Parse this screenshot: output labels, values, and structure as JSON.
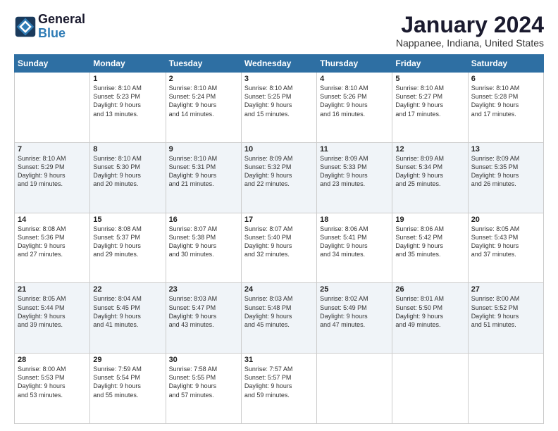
{
  "header": {
    "logo_line1": "General",
    "logo_line2": "Blue",
    "month_year": "January 2024",
    "location": "Nappanee, Indiana, United States"
  },
  "days_of_week": [
    "Sunday",
    "Monday",
    "Tuesday",
    "Wednesday",
    "Thursday",
    "Friday",
    "Saturday"
  ],
  "weeks": [
    [
      {
        "day": "",
        "sunrise": "",
        "sunset": "",
        "daylight": ""
      },
      {
        "day": "1",
        "sunrise": "Sunrise: 8:10 AM",
        "sunset": "Sunset: 5:23 PM",
        "daylight": "Daylight: 9 hours and 13 minutes."
      },
      {
        "day": "2",
        "sunrise": "Sunrise: 8:10 AM",
        "sunset": "Sunset: 5:24 PM",
        "daylight": "Daylight: 9 hours and 14 minutes."
      },
      {
        "day": "3",
        "sunrise": "Sunrise: 8:10 AM",
        "sunset": "Sunset: 5:25 PM",
        "daylight": "Daylight: 9 hours and 15 minutes."
      },
      {
        "day": "4",
        "sunrise": "Sunrise: 8:10 AM",
        "sunset": "Sunset: 5:26 PM",
        "daylight": "Daylight: 9 hours and 16 minutes."
      },
      {
        "day": "5",
        "sunrise": "Sunrise: 8:10 AM",
        "sunset": "Sunset: 5:27 PM",
        "daylight": "Daylight: 9 hours and 17 minutes."
      },
      {
        "day": "6",
        "sunrise": "Sunrise: 8:10 AM",
        "sunset": "Sunset: 5:28 PM",
        "daylight": "Daylight: 9 hours and 17 minutes."
      }
    ],
    [
      {
        "day": "7",
        "sunrise": "Sunrise: 8:10 AM",
        "sunset": "Sunset: 5:29 PM",
        "daylight": "Daylight: 9 hours and 19 minutes."
      },
      {
        "day": "8",
        "sunrise": "Sunrise: 8:10 AM",
        "sunset": "Sunset: 5:30 PM",
        "daylight": "Daylight: 9 hours and 20 minutes."
      },
      {
        "day": "9",
        "sunrise": "Sunrise: 8:10 AM",
        "sunset": "Sunset: 5:31 PM",
        "daylight": "Daylight: 9 hours and 21 minutes."
      },
      {
        "day": "10",
        "sunrise": "Sunrise: 8:09 AM",
        "sunset": "Sunset: 5:32 PM",
        "daylight": "Daylight: 9 hours and 22 minutes."
      },
      {
        "day": "11",
        "sunrise": "Sunrise: 8:09 AM",
        "sunset": "Sunset: 5:33 PM",
        "daylight": "Daylight: 9 hours and 23 minutes."
      },
      {
        "day": "12",
        "sunrise": "Sunrise: 8:09 AM",
        "sunset": "Sunset: 5:34 PM",
        "daylight": "Daylight: 9 hours and 25 minutes."
      },
      {
        "day": "13",
        "sunrise": "Sunrise: 8:09 AM",
        "sunset": "Sunset: 5:35 PM",
        "daylight": "Daylight: 9 hours and 26 minutes."
      }
    ],
    [
      {
        "day": "14",
        "sunrise": "Sunrise: 8:08 AM",
        "sunset": "Sunset: 5:36 PM",
        "daylight": "Daylight: 9 hours and 27 minutes."
      },
      {
        "day": "15",
        "sunrise": "Sunrise: 8:08 AM",
        "sunset": "Sunset: 5:37 PM",
        "daylight": "Daylight: 9 hours and 29 minutes."
      },
      {
        "day": "16",
        "sunrise": "Sunrise: 8:07 AM",
        "sunset": "Sunset: 5:38 PM",
        "daylight": "Daylight: 9 hours and 30 minutes."
      },
      {
        "day": "17",
        "sunrise": "Sunrise: 8:07 AM",
        "sunset": "Sunset: 5:40 PM",
        "daylight": "Daylight: 9 hours and 32 minutes."
      },
      {
        "day": "18",
        "sunrise": "Sunrise: 8:06 AM",
        "sunset": "Sunset: 5:41 PM",
        "daylight": "Daylight: 9 hours and 34 minutes."
      },
      {
        "day": "19",
        "sunrise": "Sunrise: 8:06 AM",
        "sunset": "Sunset: 5:42 PM",
        "daylight": "Daylight: 9 hours and 35 minutes."
      },
      {
        "day": "20",
        "sunrise": "Sunrise: 8:05 AM",
        "sunset": "Sunset: 5:43 PM",
        "daylight": "Daylight: 9 hours and 37 minutes."
      }
    ],
    [
      {
        "day": "21",
        "sunrise": "Sunrise: 8:05 AM",
        "sunset": "Sunset: 5:44 PM",
        "daylight": "Daylight: 9 hours and 39 minutes."
      },
      {
        "day": "22",
        "sunrise": "Sunrise: 8:04 AM",
        "sunset": "Sunset: 5:45 PM",
        "daylight": "Daylight: 9 hours and 41 minutes."
      },
      {
        "day": "23",
        "sunrise": "Sunrise: 8:03 AM",
        "sunset": "Sunset: 5:47 PM",
        "daylight": "Daylight: 9 hours and 43 minutes."
      },
      {
        "day": "24",
        "sunrise": "Sunrise: 8:03 AM",
        "sunset": "Sunset: 5:48 PM",
        "daylight": "Daylight: 9 hours and 45 minutes."
      },
      {
        "day": "25",
        "sunrise": "Sunrise: 8:02 AM",
        "sunset": "Sunset: 5:49 PM",
        "daylight": "Daylight: 9 hours and 47 minutes."
      },
      {
        "day": "26",
        "sunrise": "Sunrise: 8:01 AM",
        "sunset": "Sunset: 5:50 PM",
        "daylight": "Daylight: 9 hours and 49 minutes."
      },
      {
        "day": "27",
        "sunrise": "Sunrise: 8:00 AM",
        "sunset": "Sunset: 5:52 PM",
        "daylight": "Daylight: 9 hours and 51 minutes."
      }
    ],
    [
      {
        "day": "28",
        "sunrise": "Sunrise: 8:00 AM",
        "sunset": "Sunset: 5:53 PM",
        "daylight": "Daylight: 9 hours and 53 minutes."
      },
      {
        "day": "29",
        "sunrise": "Sunrise: 7:59 AM",
        "sunset": "Sunset: 5:54 PM",
        "daylight": "Daylight: 9 hours and 55 minutes."
      },
      {
        "day": "30",
        "sunrise": "Sunrise: 7:58 AM",
        "sunset": "Sunset: 5:55 PM",
        "daylight": "Daylight: 9 hours and 57 minutes."
      },
      {
        "day": "31",
        "sunrise": "Sunrise: 7:57 AM",
        "sunset": "Sunset: 5:57 PM",
        "daylight": "Daylight: 9 hours and 59 minutes."
      },
      {
        "day": "",
        "sunrise": "",
        "sunset": "",
        "daylight": ""
      },
      {
        "day": "",
        "sunrise": "",
        "sunset": "",
        "daylight": ""
      },
      {
        "day": "",
        "sunrise": "",
        "sunset": "",
        "daylight": ""
      }
    ]
  ]
}
